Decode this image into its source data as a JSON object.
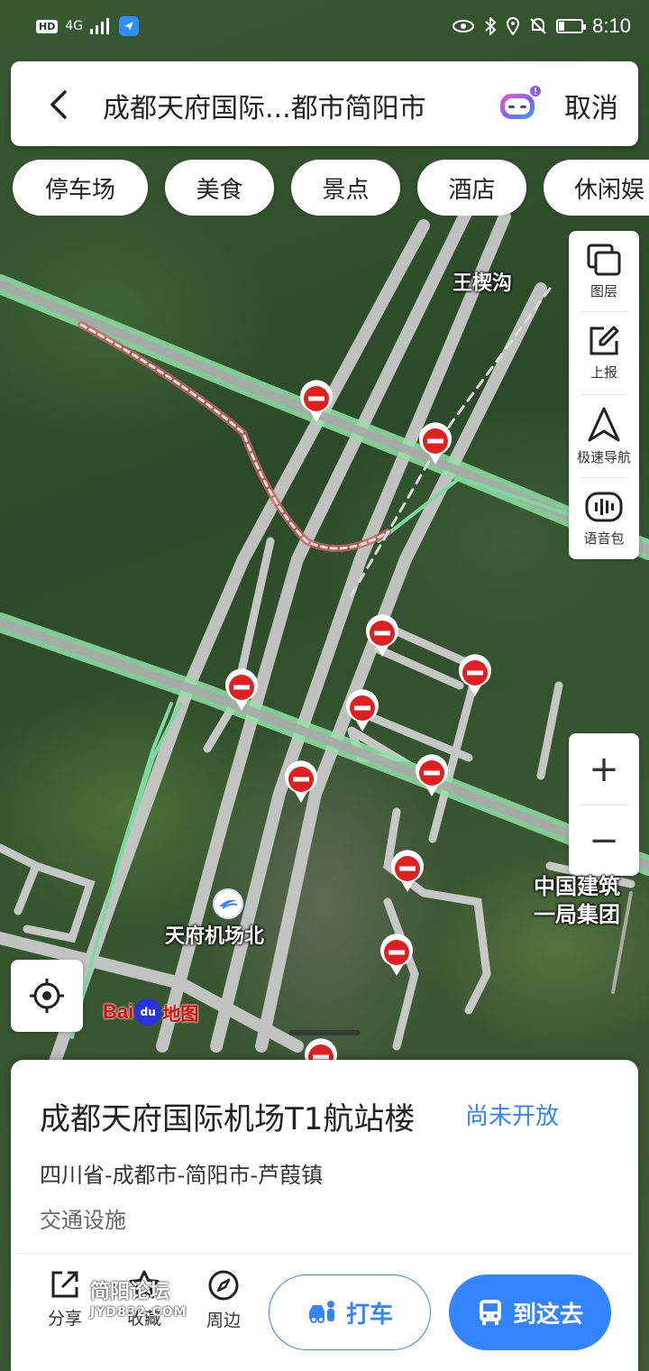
{
  "status_bar": {
    "network": "HD",
    "signal": "4G",
    "time": "8:10",
    "battery_level": 0.25
  },
  "search": {
    "back_icon": "chevron-left-icon",
    "query": "成都天府国际...都市简阳市",
    "assistant_icon": "robot-assistant-icon",
    "cancel_label": "取消"
  },
  "categories": [
    "停车场",
    "美食",
    "景点",
    "酒店",
    "休闲娱"
  ],
  "toolbar": {
    "items": [
      {
        "icon": "layers-icon",
        "label": "图层"
      },
      {
        "icon": "report-icon",
        "label": "上报"
      },
      {
        "icon": "navigation-icon",
        "label": "极速导航"
      },
      {
        "icon": "voice-pack-icon",
        "label": "语音包"
      }
    ]
  },
  "zoom": {
    "in": "+",
    "out": "−"
  },
  "map": {
    "labels": {
      "village": "王楔沟",
      "station": "天府机场北",
      "company_line1": "中国建筑",
      "company_line2": "一局集团"
    },
    "logo": {
      "bai": "Bai",
      "du": "du",
      "map": "地图"
    }
  },
  "place": {
    "name": "成都天府国际机场T1航站楼",
    "status": "尚未开放",
    "address": "四川省-成都市-简阳市-芦葭镇",
    "category": "交通设施"
  },
  "actions": {
    "share": "分享",
    "favorite": "收藏",
    "nearby": "周边",
    "taxi": "打车",
    "go": "到这去"
  },
  "watermark": {
    "line1": "简阳论坛",
    "line2": "JYD832.COM"
  },
  "colors": {
    "accent": "#3385ff",
    "road": "#d9d9d9",
    "highway": "#7fd8a0",
    "closure": "#e02020"
  }
}
